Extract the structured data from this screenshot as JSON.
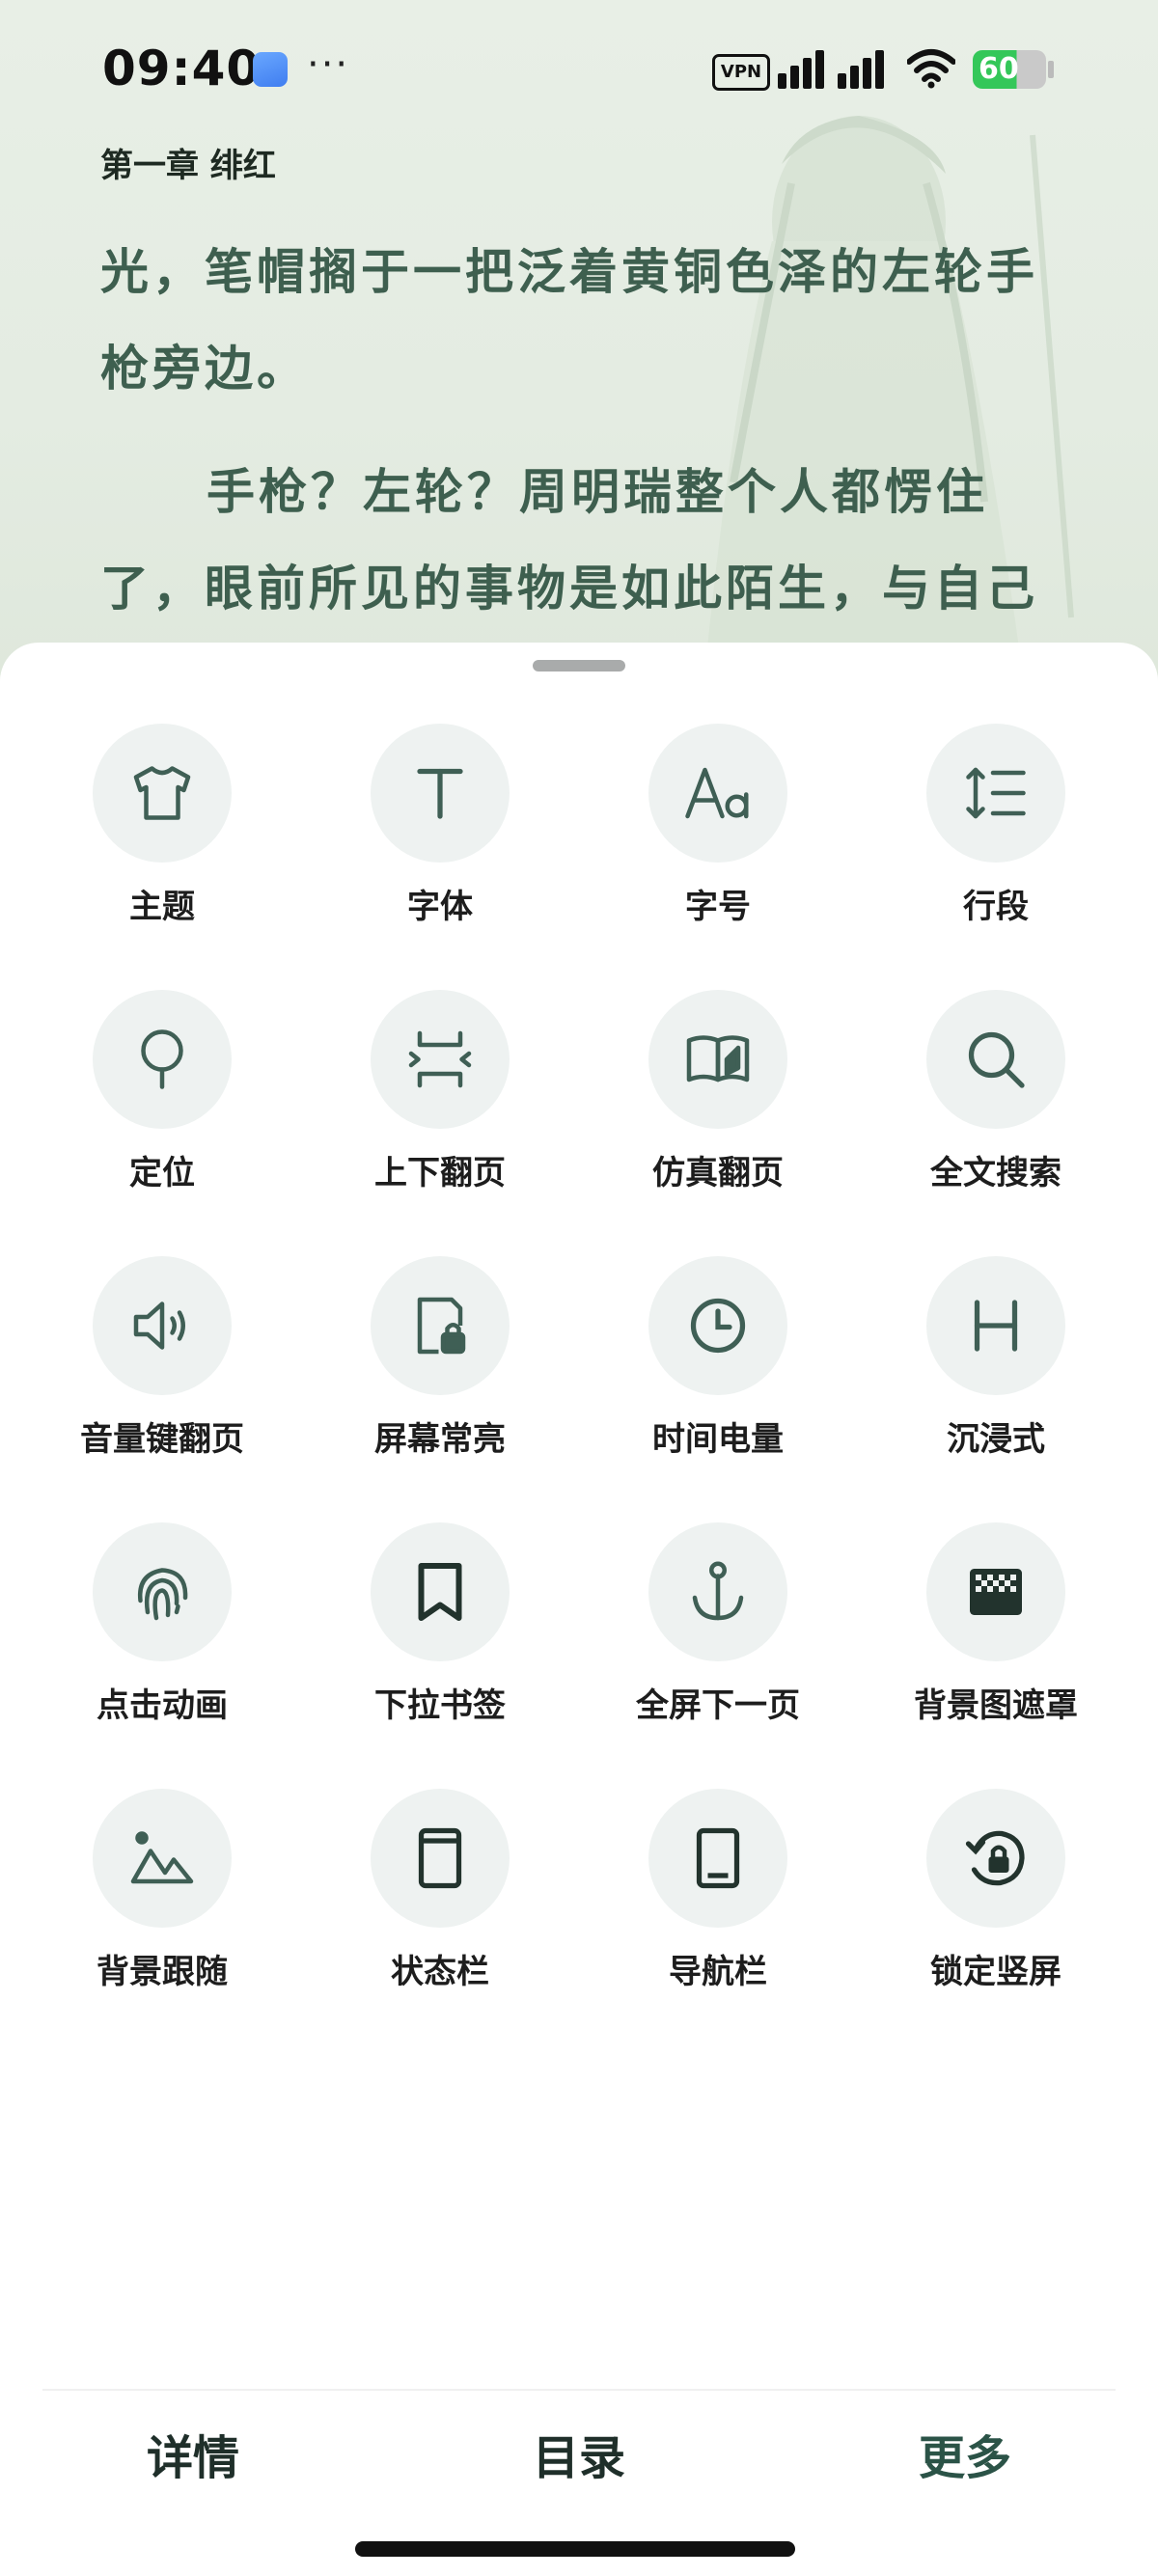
{
  "status_bar": {
    "time": "09:40",
    "dots": "···",
    "vpn": "VPN",
    "battery": "60"
  },
  "reader": {
    "chapter_title": "第一章 绯红",
    "paragraphs": [
      "光，笔帽搁于一把泛着黄铜色泽的左轮手枪旁边。",
      "手枪？左轮？周明瑞整个人都愣住了，眼前所见的事物是如此陌生，与自己房间"
    ]
  },
  "settings": [
    {
      "label": "主题",
      "icon": "shirt-icon"
    },
    {
      "label": "字体",
      "icon": "font-t-icon"
    },
    {
      "label": "字号",
      "icon": "font-size-icon"
    },
    {
      "label": "行段",
      "icon": "line-spacing-icon"
    },
    {
      "label": "定位",
      "icon": "location-pin-icon"
    },
    {
      "label": "上下翻页",
      "icon": "vertical-flip-icon"
    },
    {
      "label": "仿真翻页",
      "icon": "book-open-icon"
    },
    {
      "label": "全文搜索",
      "icon": "search-icon"
    },
    {
      "label": "音量键翻页",
      "icon": "volume-icon"
    },
    {
      "label": "屏幕常亮",
      "icon": "screen-lock-icon"
    },
    {
      "label": "时间电量",
      "icon": "clock-icon"
    },
    {
      "label": "沉浸式",
      "icon": "immersive-h-icon"
    },
    {
      "label": "点击动画",
      "icon": "fingerprint-icon"
    },
    {
      "label": "下拉书签",
      "icon": "bookmark-icon"
    },
    {
      "label": "全屏下一页",
      "icon": "anchor-icon"
    },
    {
      "label": "背景图遮罩",
      "icon": "mask-icon"
    },
    {
      "label": "背景跟随",
      "icon": "landscape-icon"
    },
    {
      "label": "状态栏",
      "icon": "status-bar-icon"
    },
    {
      "label": "导航栏",
      "icon": "navigation-bar-icon"
    },
    {
      "label": "锁定竖屏",
      "icon": "rotate-lock-icon"
    }
  ],
  "bottom_nav": {
    "details": "详情",
    "toc": "目录",
    "more": "更多"
  },
  "colors": {
    "icon": "#3f5f55",
    "icon_bg": "#eef2f1",
    "reader_text": "#3e5f4f"
  }
}
